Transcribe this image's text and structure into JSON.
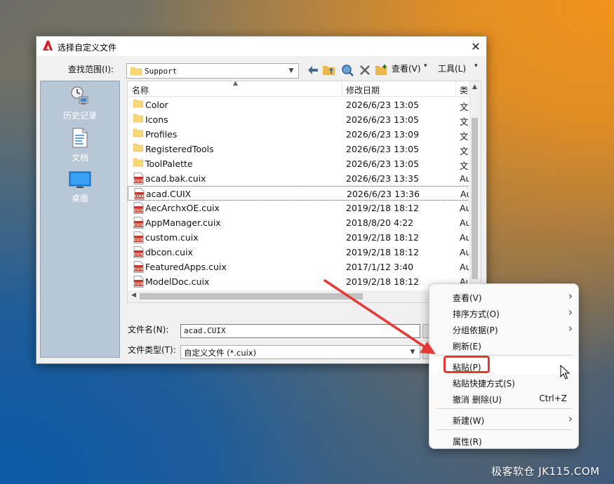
{
  "dialog": {
    "title": "选择自定义文件",
    "close_glyph": "✕",
    "look_in_label": "查找范围(I):",
    "look_in_value": "Support",
    "view_menu": "查看(V)",
    "tools_menu": "工具(L)",
    "places": [
      {
        "label": "历史记录",
        "icon": "history-icon"
      },
      {
        "label": "文档",
        "icon": "documents-icon"
      },
      {
        "label": "桌面",
        "icon": "desktop-icon"
      }
    ],
    "columns": {
      "name": "名称",
      "date": "修改日期",
      "type": "类"
    },
    "files": [
      {
        "name": "Color",
        "date": "2026/6/23 13:05",
        "type": "文",
        "kind": "folder"
      },
      {
        "name": "Icons",
        "date": "2026/6/23 13:05",
        "type": "文",
        "kind": "folder"
      },
      {
        "name": "Profiles",
        "date": "2026/6/23 13:09",
        "type": "文",
        "kind": "folder"
      },
      {
        "name": "RegisteredTools",
        "date": "2026/6/23 13:05",
        "type": "文",
        "kind": "folder"
      },
      {
        "name": "ToolPalette",
        "date": "2026/6/23 13:05",
        "type": "文",
        "kind": "folder"
      },
      {
        "name": "acad.bak.cuix",
        "date": "2026/6/23 13:35",
        "type": "Au",
        "kind": "cuix"
      },
      {
        "name": "acad.CUIX",
        "date": "2026/6/23 13:36",
        "type": "Au",
        "kind": "cuix",
        "selected": true
      },
      {
        "name": "AecArchxOE.cuix",
        "date": "2019/2/18 18:12",
        "type": "Au",
        "kind": "cuix"
      },
      {
        "name": "AppManager.cuix",
        "date": "2018/8/20 4:22",
        "type": "Au",
        "kind": "cuix"
      },
      {
        "name": "custom.cuix",
        "date": "2019/2/18 18:12",
        "type": "Au",
        "kind": "cuix"
      },
      {
        "name": "dbcon.cuix",
        "date": "2019/2/18 18:12",
        "type": "Au",
        "kind": "cuix"
      },
      {
        "name": "FeaturedApps.cuix",
        "date": "2017/1/12 3:40",
        "type": "Au",
        "kind": "cuix"
      },
      {
        "name": "ModelDoc.cuix",
        "date": "2019/2/18 18:12",
        "type": "Au",
        "kind": "cuix"
      }
    ],
    "file_icon_text": "CUIX",
    "file_name_label": "文件名(N):",
    "file_name_value": "acad.CUIX",
    "file_type_label": "文件类型(T):",
    "file_type_value": "自定义文件 (*.cuix)"
  },
  "context_menu": {
    "items": [
      {
        "label": "查看(V)",
        "submenu": true
      },
      {
        "label": "排序方式(O)",
        "submenu": true
      },
      {
        "label": "分组依据(P)",
        "submenu": true
      },
      {
        "label": "刷新(E)"
      },
      {
        "label": "粘贴(P)",
        "highlighted": true
      },
      {
        "label": "粘贴快捷方式(S)"
      },
      {
        "label": "撤消 删除(U)",
        "shortcut": "Ctrl+Z"
      },
      {
        "label": "新建(W)",
        "submenu": true
      },
      {
        "label": "属性(R)"
      }
    ],
    "chevron_glyph": "›"
  },
  "annotation": {
    "highlight_color": "#e53935",
    "arrow_color": "#e53935"
  },
  "watermark": "极客软仓 JK115.COM"
}
